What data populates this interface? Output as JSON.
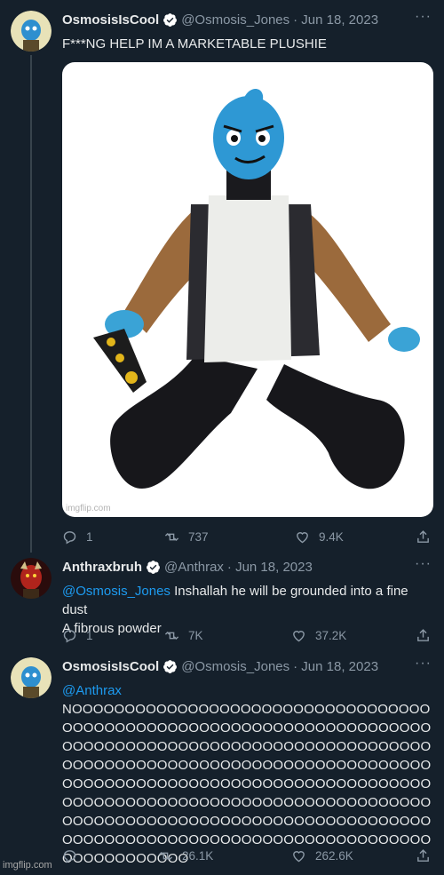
{
  "tweets": [
    {
      "name": "OsmosisIsCool",
      "handle": "@Osmosis_Jones",
      "date": "· Jun 18, 2023",
      "text": "F***NG HELP IM A MARKETABLE PLUSHIE",
      "media_watermark": "imgflip.com",
      "replies": "1",
      "retweets": "737",
      "likes": "9.4K"
    },
    {
      "name": "Anthraxbruh",
      "handle": "@Anthrax",
      "date": "· Jun 18, 2023",
      "mention": "@Osmosis_Jones",
      "text_line1": " Inshallah he will be grounded into a fine dust",
      "text_line2": "A fibrous powder",
      "replies": "1",
      "retweets": "7K",
      "likes": "37.2K"
    },
    {
      "name": "OsmosisIsCool",
      "handle": "@Osmosis_Jones",
      "date": "· Jun 18, 2023",
      "mention": "@Anthrax",
      "text": "NOOOOOOOOOOOOOOOOOOOOOOOOOOOOOOOOOOOOOOOOOOOOOOOOOOOOOOOOOOOOOOOOOOOOOOOOOOOOOOOOOOOOOOOOOOOOOOOOOOOOOOOOOOOOOOOOOOOOOOOOOOOOOOOOOOOOOOOOOOOOOOOOOOOOOOOOOOOOOOOOOOOOOOOOOOOOOOOOOOOOOOOOOOOOOOOOOOOOOOOOOOOOOOOOOOOOOOOOOOOOOOOOOOOOOOOOOOOOOOOOOOOOOOOOOOOOOOOOOOOOOOOOOOOOOOOOOOOOOOOOOOOOOOOOOOO",
      "retweets": "26.1K",
      "likes": "262.6K"
    }
  ],
  "page_watermark": "imgflip.com",
  "more_label": "···",
  "icons": [
    "reply-icon",
    "retweet-icon",
    "like-icon",
    "share-icon",
    "verified-badge-icon"
  ],
  "colors": {
    "background": "#15202b",
    "text": "#e7e9ea",
    "muted": "#8b98a5",
    "link": "#1d9bf0",
    "verified": "#ffffff"
  }
}
